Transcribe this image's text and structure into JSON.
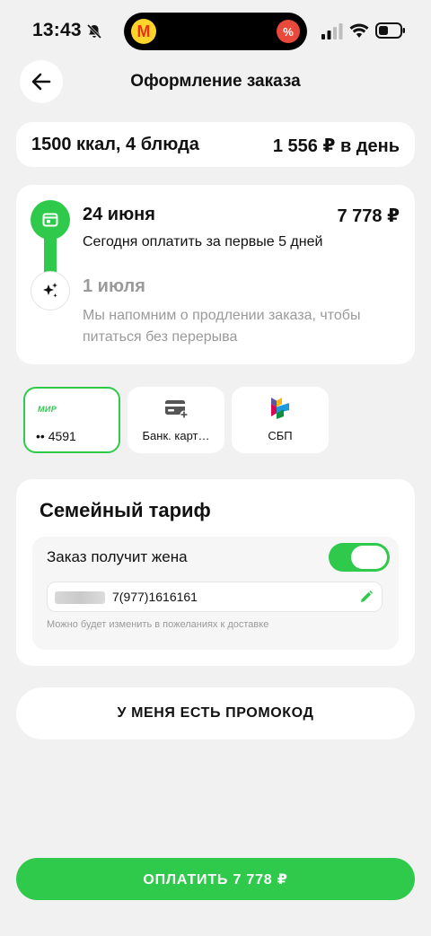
{
  "status_bar": {
    "time": "13:43"
  },
  "header": {
    "title": "Оформление заказа"
  },
  "summary": {
    "plan": "1500 ккал, 4 блюда",
    "price_per_day": "1 556 ₽ в день"
  },
  "schedule": {
    "steps": [
      {
        "date": "24 июня",
        "amount": "7 778 ₽",
        "description": "Сегодня оплатить за первые 5 дней"
      },
      {
        "date": "1 июля",
        "description": "Мы напомним о продлении заказа, чтобы питаться без перерыва"
      }
    ]
  },
  "payment_methods": [
    {
      "logo": "МИР",
      "label": "•• 4591",
      "selected": true
    },
    {
      "label": "Банк. карт…",
      "selected": false
    },
    {
      "label": "СБП",
      "selected": false
    }
  ],
  "family": {
    "title": "Семейный тариф",
    "toggle_label": "Заказ получит жена",
    "toggle_on": true,
    "phone": "7(977)1616161",
    "hint": "Можно будет изменить в пожеланиях к доставке"
  },
  "promo": {
    "label": "У МЕНЯ ЕСТЬ ПРОМОКОД"
  },
  "pay_button": {
    "label": "ОПЛАТИТЬ 7 778 ₽"
  },
  "colors": {
    "accent": "#2fc94c",
    "background": "#f1f1f1",
    "muted": "#9a9a9a"
  }
}
